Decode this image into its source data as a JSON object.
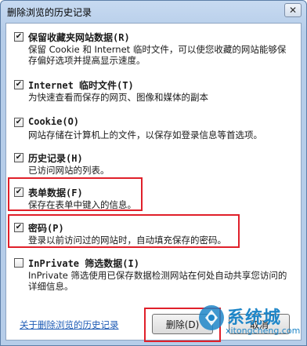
{
  "window": {
    "title": "删除浏览的历史记录",
    "close_glyph": "✕"
  },
  "options": [
    {
      "checked": true,
      "title": "保留收藏夹网站数据(R)",
      "desc": "保留 Cookie 和 Internet 临时文件，可以使您收藏的网站能够保存偏好选项并提高显示速度。"
    },
    {
      "checked": true,
      "title": "Internet 临时文件(T)",
      "desc": "为快速查看而保存的网页、图像和媒体的副本"
    },
    {
      "checked": true,
      "title": "Cookie(O)",
      "desc": "网站存储在计算机上的文件，以保存如登录信息等首选项。"
    },
    {
      "checked": true,
      "title": "历史记录(H)",
      "desc": "已访问网站的列表。"
    },
    {
      "checked": true,
      "title": "表单数据(F)",
      "desc": "保存在表单中键入的信息。"
    },
    {
      "checked": true,
      "title": "密码(P)",
      "desc": "登录以前访问过的网站时，自动填充保存的密码。"
    },
    {
      "checked": false,
      "title": "InPrivate 筛选数据(I)",
      "desc": "InPrivate 筛选使用已保存数据检测网站在何处自动共享您访问的详细信息。"
    }
  ],
  "footer": {
    "link_text": "关于删除浏览的历史记录",
    "delete_label": "删除(D)",
    "cancel_label": "取消"
  },
  "watermark": {
    "text": "系统城",
    "sub": "xitongcheng.com"
  },
  "colors": {
    "highlight": "#e0202a",
    "link": "#1d5bb5",
    "watermark": "#1f86c8"
  }
}
